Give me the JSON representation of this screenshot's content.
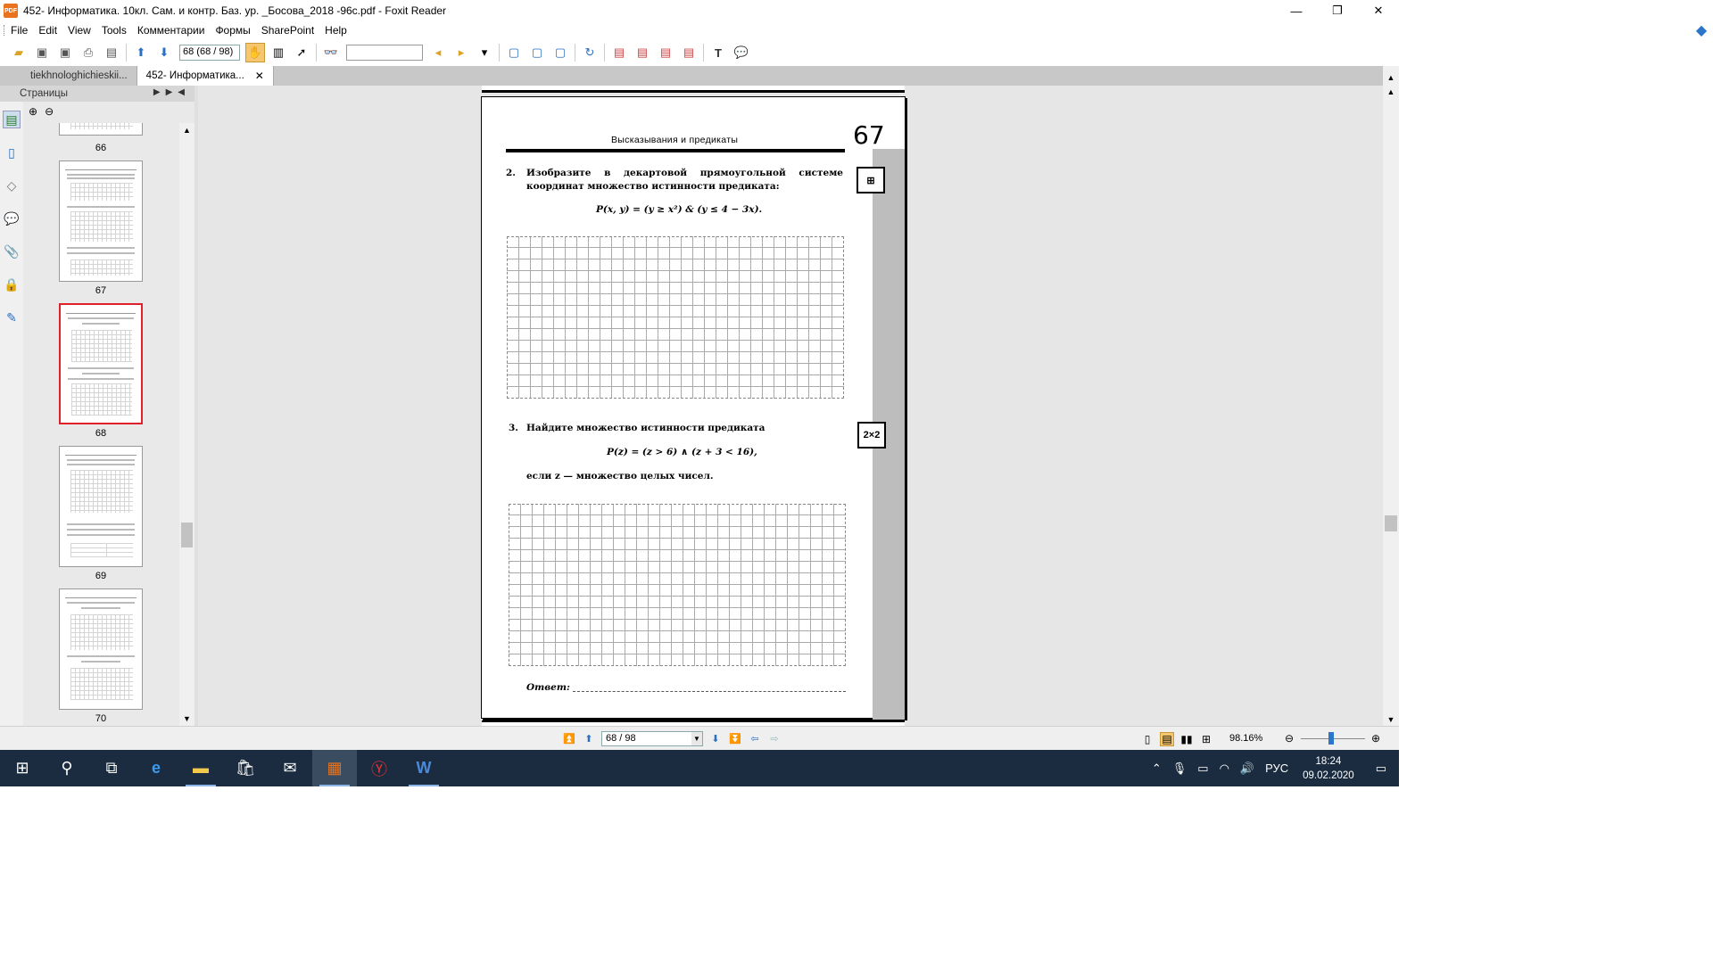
{
  "window": {
    "title": "452- Информатика. 10кл. Сам. и контр. Баз. ур. _Босова_2018 -96с.pdf - Foxit Reader",
    "app_icon_text": "PDF",
    "minimize": "—",
    "restore": "❐",
    "close": "✕"
  },
  "menu": [
    "File",
    "Edit",
    "View",
    "Tools",
    "Комментарии",
    "Формы",
    "SharePoint",
    "Help"
  ],
  "toolbar": {
    "page_field": "68 (68 / 98)",
    "search_value": ""
  },
  "tabs": [
    {
      "label": "tiekhnologhichieskii..."
    },
    {
      "label": "452- Информатика...",
      "close": "✕"
    }
  ],
  "panel": {
    "title": "Страницы",
    "thumbnails": [
      {
        "num": "66"
      },
      {
        "num": "67"
      },
      {
        "num": "68"
      },
      {
        "num": "69"
      },
      {
        "num": "70"
      }
    ]
  },
  "page": {
    "header": "Высказывания и предикаты",
    "number": "67",
    "task2": {
      "num": "2.",
      "text": "Изобразите в декартовой прямоугольной системе координат множество истинности предиката:",
      "formula": "P(x, y) = (y ≥ x²) & (y ≤ 4 − 3x)."
    },
    "task3": {
      "num": "3.",
      "text": "Найдите множество истинности предиката",
      "formula": "P(z) = (z > 6) ∧ (z + 3 < 16),",
      "condition": "если z — множество целых чисел.",
      "icon_label": "2×2"
    },
    "answer_label": "Ответ:"
  },
  "status": {
    "page_field": "68 / 98",
    "zoom": "98.16%"
  },
  "taskbar": {
    "lang": "РУС",
    "time": "18:24",
    "date": "09.02.2020"
  }
}
